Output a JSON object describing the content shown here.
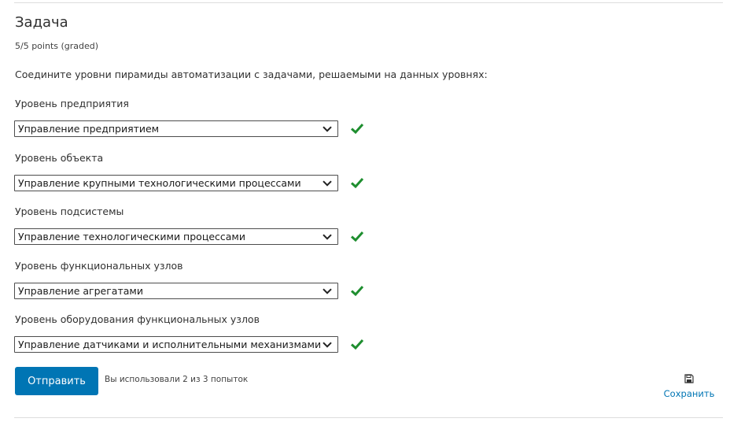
{
  "problem": {
    "title": "Задача",
    "grade": "5/5 points (graded)",
    "prompt": "Соедините уровни пирамиды автоматизации с задачами, решаемыми на данных уровнях:"
  },
  "levels": [
    {
      "label": "Уровень предприятия",
      "selected": "Управление предприятием",
      "status": "correct"
    },
    {
      "label": "Уровень объекта",
      "selected": "Управление крупными технологическими процессами",
      "status": "correct"
    },
    {
      "label": "Уровень подсистемы",
      "selected": "Управление технологическими процессами",
      "status": "correct"
    },
    {
      "label": "Уровень функциональных узлов",
      "selected": "Управление агрегатами",
      "status": "correct"
    },
    {
      "label": "Уровень оборудования функциональных узлов",
      "selected": "Управление датчиками и исполнительными механизмами",
      "status": "correct"
    }
  ],
  "actions": {
    "submit_label": "Отправить",
    "attempts_text": "Вы использовали 2 из 3 попыток",
    "save_label": "Сохранить"
  },
  "colors": {
    "accent": "#0075b4",
    "check": "#1e8e2f",
    "text": "#313131"
  },
  "icons": {
    "dropdown": "chevron-down-icon",
    "status": "checkmark-icon",
    "save": "floppy-disk-icon"
  }
}
